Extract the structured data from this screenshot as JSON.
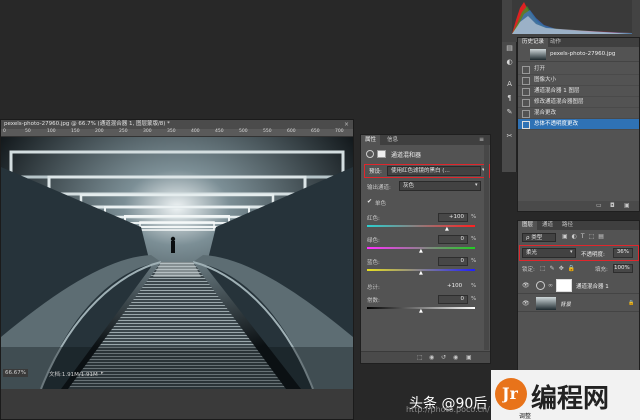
{
  "document": {
    "title": "pexels-photo-27960.jpg @ 66.7% (通道混合器 1, 图层蒙版/8) *",
    "ruler_ticks": [
      "0",
      "50",
      "100",
      "150",
      "200",
      "250",
      "300",
      "350",
      "400",
      "450",
      "500",
      "550",
      "600",
      "650",
      "700"
    ],
    "zoom": "66.67%",
    "status": "文档:1.91M/1.91M"
  },
  "properties_panel": {
    "tabs": [
      "属性",
      "信息"
    ],
    "header": "通道混和器",
    "preset_label": "预设:",
    "preset_value": "使用红色滤镜的黑白 (…",
    "output_label": "输出通道:",
    "output_value": "灰色",
    "monochrome_label": "单色",
    "red_label": "红色:",
    "red_value": "+100",
    "green_label": "绿色:",
    "green_value": "0",
    "blue_label": "蓝色:",
    "blue_value": "0",
    "total_label": "总计:",
    "total_value": "+100",
    "constant_label": "常数:",
    "constant_value": "0",
    "percent": "%"
  },
  "history_panel": {
    "tabs": [
      "历史记录",
      "动作"
    ],
    "snapshot": "pexels-photo-27960.jpg",
    "items": [
      {
        "label": "打开",
        "selected": false
      },
      {
        "label": "图像大小",
        "selected": false
      },
      {
        "label": "通道混合器 1 图层",
        "selected": false
      },
      {
        "label": "修改通道混合器图层",
        "selected": false
      },
      {
        "label": "混合更改",
        "selected": false
      },
      {
        "label": "总体不透明度更改",
        "selected": true
      }
    ]
  },
  "layers_panel": {
    "tabs": [
      "图层",
      "通道",
      "路径"
    ],
    "kind_label": "ρ 类型",
    "blend_mode": "柔光",
    "opacity_label": "不透明度:",
    "opacity_value": "36%",
    "lock_label": "锁定:",
    "fill_label": "填充:",
    "fill_value": "100%",
    "layers": [
      {
        "name": "通道混合器 1"
      },
      {
        "name": "背景"
      }
    ]
  },
  "watermark": {
    "text": "头条 @90后",
    "url": "http://photo.poco.cn/",
    "logo_text": "编程网",
    "logo_badge": "Jr",
    "logo_fragment": "调整"
  },
  "colors": {
    "highlight": "#2f72b5",
    "annotation_red": "#e0262c",
    "logo_orange": "#e8731a"
  }
}
